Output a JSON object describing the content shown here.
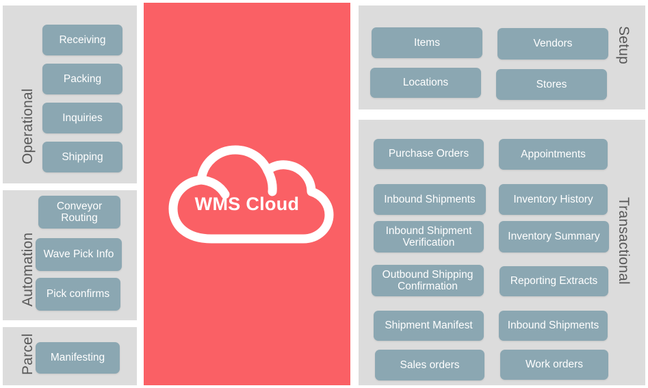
{
  "diagram": {
    "title": "WMS Cloud",
    "center": {
      "label": "WMS Cloud",
      "icon": "cloud-icon",
      "background_color": "#FA6065",
      "foreground_color": "#FFFFFF"
    },
    "colors": {
      "panel_background": "#DCDCDC",
      "chip_fill": "#8BA7B2",
      "chip_text": "#FFFFFF",
      "group_label_text": "#595959",
      "accent": "#FA6065",
      "page_background": "#FFFFFF"
    },
    "groups": [
      {
        "id": "operational",
        "label": "Operational",
        "side": "left",
        "label_rotation": "ccw",
        "items": [
          {
            "label": "Receiving"
          },
          {
            "label": "Packing"
          },
          {
            "label": "Inquiries"
          },
          {
            "label": "Shipping"
          }
        ]
      },
      {
        "id": "automation",
        "label": "Automation",
        "side": "left",
        "label_rotation": "ccw",
        "items": [
          {
            "label": "Conveyor\nRouting"
          },
          {
            "label": "Wave Pick Info"
          },
          {
            "label": "Pick confirms"
          }
        ]
      },
      {
        "id": "parcel",
        "label": "Parcel",
        "side": "left",
        "label_rotation": "ccw",
        "items": [
          {
            "label": "Manifesting"
          }
        ]
      },
      {
        "id": "setup",
        "label": "Setup",
        "side": "right",
        "label_rotation": "cw",
        "items": [
          {
            "label": "Items"
          },
          {
            "label": "Vendors"
          },
          {
            "label": "Locations"
          },
          {
            "label": "Stores"
          }
        ]
      },
      {
        "id": "transactional",
        "label": "Transactional",
        "side": "right",
        "label_rotation": "cw",
        "items": [
          {
            "label": "Purchase Orders"
          },
          {
            "label": "Appointments"
          },
          {
            "label": "Inbound Shipments"
          },
          {
            "label": "Inventory History"
          },
          {
            "label": "Inbound Shipment\nVerification"
          },
          {
            "label": "Inventory Summary"
          },
          {
            "label": "Outbound Shipping\nConfirmation"
          },
          {
            "label": "Reporting Extracts"
          },
          {
            "label": "Shipment Manifest"
          },
          {
            "label": "Inbound Shipments"
          },
          {
            "label": "Sales orders"
          },
          {
            "label": "Work orders"
          }
        ]
      }
    ]
  }
}
